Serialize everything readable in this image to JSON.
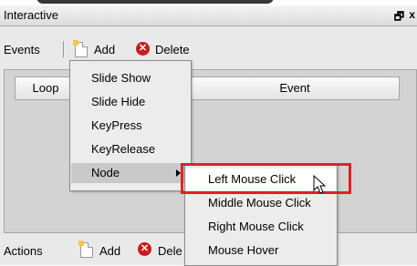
{
  "window": {
    "title": "Interactive",
    "restore_glyph": "🗗",
    "close_glyph": "x"
  },
  "events_toolbar": {
    "label": "Events",
    "add_label": "Add",
    "delete_label": "Delete"
  },
  "table": {
    "columns": [
      "Loop",
      "Event"
    ]
  },
  "menu": {
    "items": [
      {
        "label": "Slide Show"
      },
      {
        "label": "Slide Hide"
      },
      {
        "label": "KeyPress"
      },
      {
        "label": "KeyRelease"
      },
      {
        "label": "Node",
        "has_submenu": true
      }
    ]
  },
  "submenu": {
    "items": [
      {
        "label": "Left Mouse Click"
      },
      {
        "label": "Middle Mouse Click"
      },
      {
        "label": "Right Mouse Click"
      },
      {
        "label": "Mouse Hover"
      }
    ]
  },
  "actions_toolbar": {
    "label": "Actions",
    "add_label": "Add",
    "delete_label": "Dele"
  },
  "colors": {
    "highlight_box": "#e02121",
    "delete_icon": "#c81d1d",
    "menu_bg": "#ececec",
    "panel_bg": "#e9e9e9"
  }
}
